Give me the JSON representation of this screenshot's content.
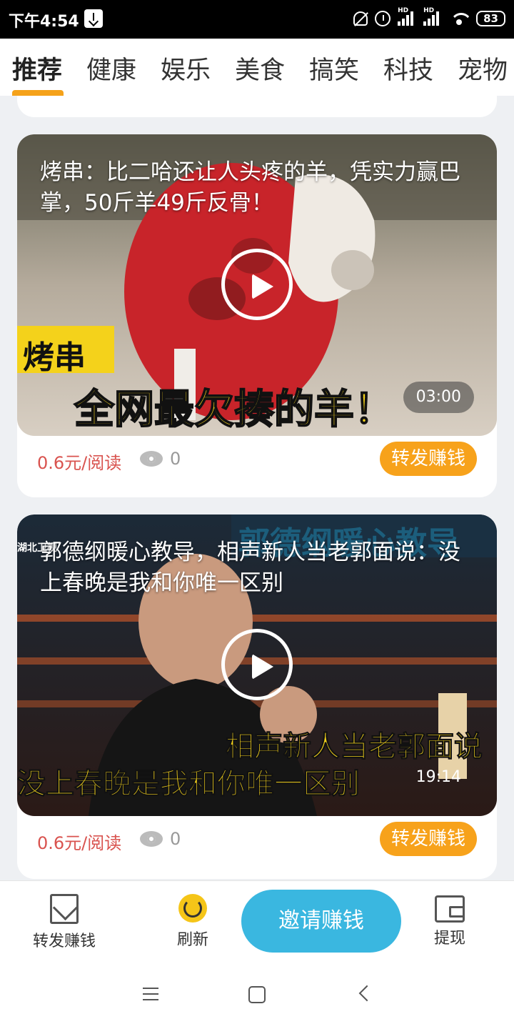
{
  "status_bar": {
    "time": "下午4:54",
    "battery": "83",
    "hd1": "HD",
    "hd2": "HD"
  },
  "tabs": [
    {
      "label": "推荐",
      "active": true
    },
    {
      "label": "健康"
    },
    {
      "label": "娱乐"
    },
    {
      "label": "美食"
    },
    {
      "label": "搞笑"
    },
    {
      "label": "科技"
    },
    {
      "label": "宠物"
    }
  ],
  "cards": [
    {
      "title": "烤串：比二哈还让人头疼的羊，凭实力赢巴掌，50斤羊49斤反骨！",
      "caption_small": "烤串",
      "caption_big": "全网最欠揍的羊！",
      "duration": "03:00",
      "rate": "0.6元/阅读",
      "views": "0",
      "share_label": "转发赚钱"
    },
    {
      "title": "郭德纲暖心教导，相声新人当老郭面说：没上春晚是我和你唯一区别",
      "caption_top": "郭德纲暖心教导",
      "caption_mid": "相声新人当老郭面说",
      "caption_bottom": "没上春晚是我和你唯一区别",
      "channel": "湖北卫视",
      "duration": "19:14",
      "rate": "0.6元/阅读",
      "views": "0",
      "share_label": "转发赚钱"
    }
  ],
  "bottom_bar": {
    "share": "转发赚钱",
    "refresh": "刷新",
    "invite": "邀请赚钱",
    "withdraw": "提现"
  },
  "colors": {
    "accent_orange": "#f7a21b",
    "invite_blue": "#3ab7e0",
    "rate_red": "#d9534f"
  }
}
